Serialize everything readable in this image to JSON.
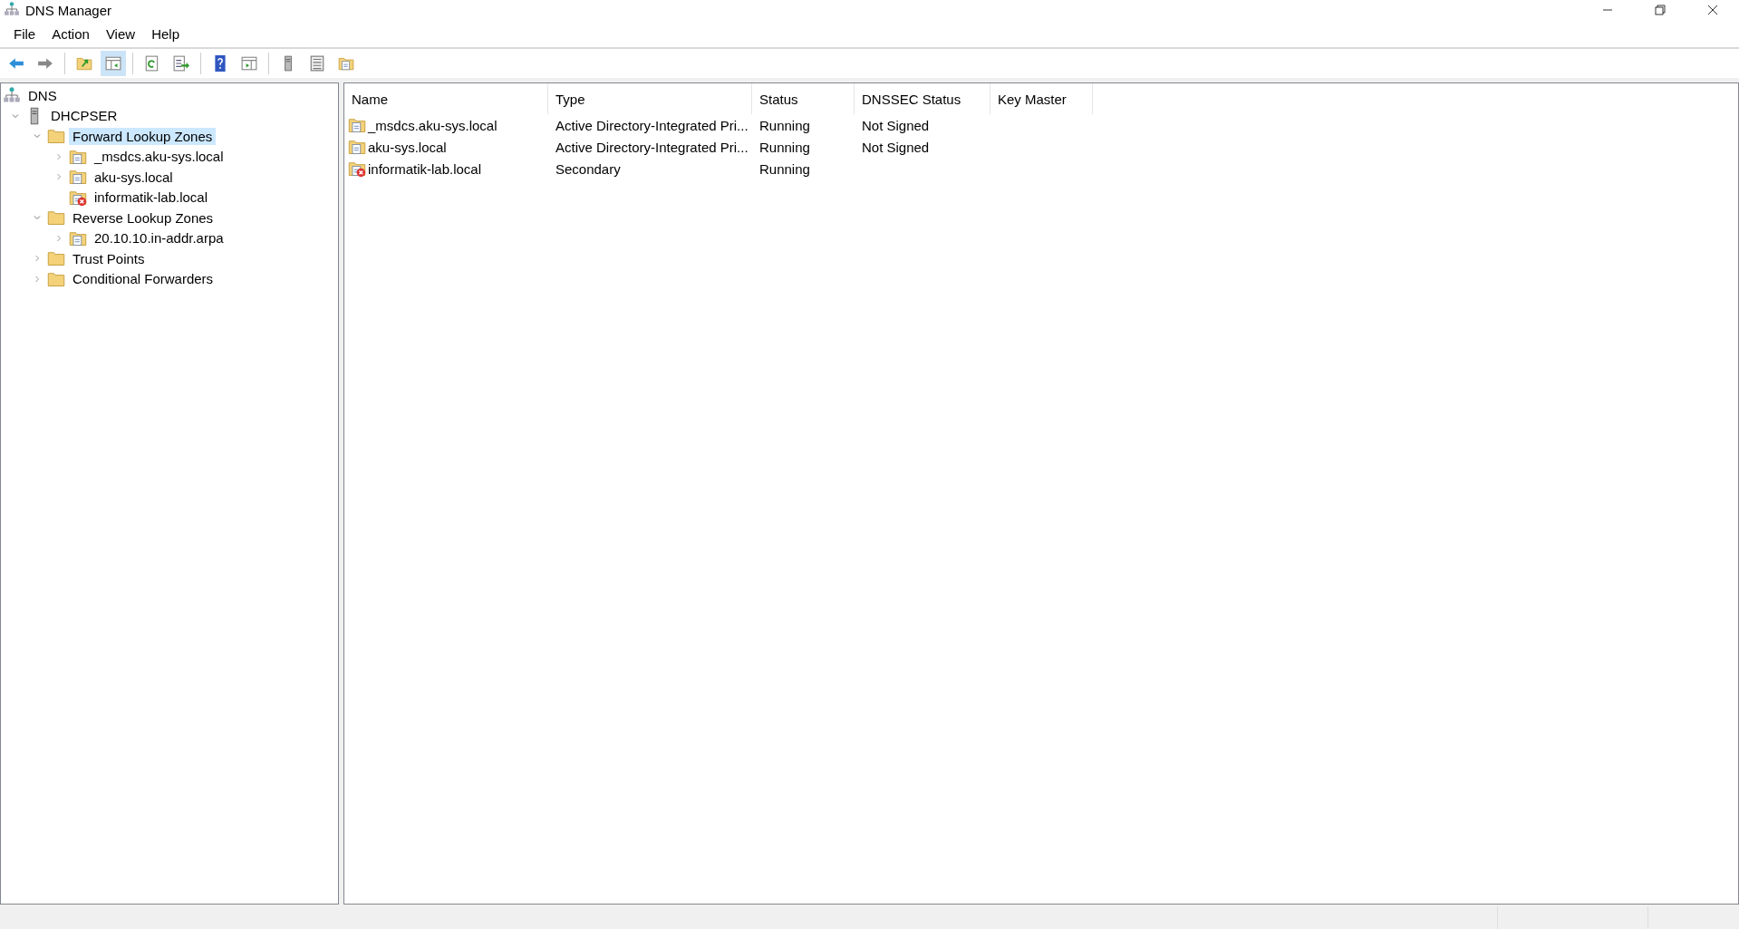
{
  "window": {
    "title": "DNS Manager"
  },
  "menu": [
    "File",
    "Action",
    "View",
    "Help"
  ],
  "toolbar": [
    {
      "kind": "back",
      "pressed": false
    },
    {
      "kind": "forward",
      "pressed": false
    },
    {
      "kind": "sep"
    },
    {
      "kind": "up",
      "pressed": false
    },
    {
      "kind": "tree",
      "pressed": true
    },
    {
      "kind": "sep"
    },
    {
      "kind": "refresh",
      "pressed": false
    },
    {
      "kind": "export",
      "pressed": false
    },
    {
      "kind": "sep"
    },
    {
      "kind": "help",
      "pressed": false
    },
    {
      "kind": "pane",
      "pressed": false
    },
    {
      "kind": "sep"
    },
    {
      "kind": "server",
      "pressed": false
    },
    {
      "kind": "list",
      "pressed": false
    },
    {
      "kind": "zone",
      "pressed": false
    }
  ],
  "tree": [
    {
      "label": "DNS",
      "kind": "dns",
      "selected": false,
      "children": [
        {
          "label": "DHCPSER",
          "kind": "server",
          "expanded": true,
          "selected": false,
          "children": [
            {
              "label": "Forward Lookup Zones",
              "kind": "folder",
              "expanded": true,
              "selected": true,
              "children": [
                {
                  "label": "_msdcs.aku-sys.local",
                  "kind": "zone",
                  "expanded": false,
                  "selected": false
                },
                {
                  "label": "aku-sys.local",
                  "kind": "zone",
                  "expanded": false,
                  "selected": false
                },
                {
                  "label": "informatik-lab.local",
                  "kind": "zone-error",
                  "selected": false
                }
              ]
            },
            {
              "label": "Reverse Lookup Zones",
              "kind": "folder",
              "expanded": true,
              "selected": false,
              "children": [
                {
                  "label": "20.10.10.in-addr.arpa",
                  "kind": "zone",
                  "expanded": false,
                  "selected": false
                }
              ]
            },
            {
              "label": "Trust Points",
              "kind": "folder",
              "expanded": false,
              "selected": false
            },
            {
              "label": "Conditional Forwarders",
              "kind": "folder",
              "expanded": false,
              "selected": false
            }
          ]
        }
      ]
    }
  ],
  "table": {
    "columns": [
      "Name",
      "Type",
      "Status",
      "DNSSEC Status",
      "Key Master"
    ],
    "rows": [
      {
        "kind": "zone",
        "cells": [
          "_msdcs.aku-sys.local",
          "Active Directory-Integrated Pri...",
          "Running",
          "Not Signed"
        ]
      },
      {
        "kind": "zone",
        "cells": [
          "aku-sys.local",
          "Active Directory-Integrated Pri...",
          "Running",
          "Not Signed"
        ]
      },
      {
        "kind": "zone-error",
        "cells": [
          "informatik-lab.local",
          "Secondary",
          "Running"
        ]
      }
    ]
  }
}
